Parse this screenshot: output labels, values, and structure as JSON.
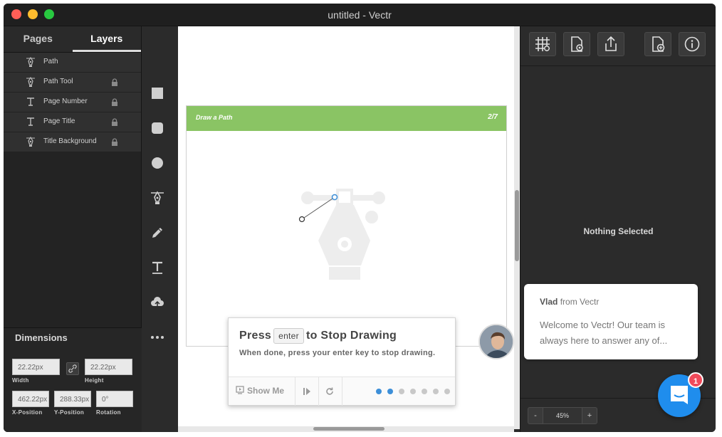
{
  "window": {
    "title": "untitled - Vectr"
  },
  "left_panel": {
    "tabs": [
      {
        "label": "Pages"
      },
      {
        "label": "Layers"
      }
    ],
    "layers": [
      {
        "name": "Path",
        "icon": "pen-icon",
        "locked": false
      },
      {
        "name": "Path Tool",
        "icon": "pen-icon",
        "locked": true
      },
      {
        "name": "Page Number",
        "icon": "text-icon",
        "locked": true
      },
      {
        "name": "Page Title",
        "icon": "text-icon",
        "locked": true
      },
      {
        "name": "Title Background",
        "icon": "pen-icon",
        "locked": true
      }
    ],
    "dimensions": {
      "title": "Dimensions",
      "width": {
        "value": "22.22px",
        "label": "Width"
      },
      "height": {
        "value": "22.22px",
        "label": "Height"
      },
      "x": {
        "value": "462.22px",
        "label": "X-Position"
      },
      "y": {
        "value": "288.33px",
        "label": "Y-Position"
      },
      "rotation": {
        "value": "0°",
        "label": "Rotation"
      }
    }
  },
  "tools": [
    "rectangle-tool-icon",
    "rounded-rect-tool-icon",
    "ellipse-tool-icon",
    "pen-tool-icon",
    "pencil-tool-icon",
    "text-tool-icon",
    "upload-tool-icon",
    "more-icon"
  ],
  "canvas": {
    "artboard_title": "Draw a Path",
    "page_number": "2/7"
  },
  "right_panel": {
    "toolbar": [
      "grid-icon",
      "page-settings-icon",
      "share-icon",
      "add-page-icon",
      "info-icon"
    ],
    "status": "Nothing Selected",
    "zoom": {
      "minus": "-",
      "value": "45%",
      "plus": "+"
    }
  },
  "tutorial": {
    "title_before": "Press",
    "key": "enter",
    "title_after": "to Stop Drawing",
    "subtitle": "When done, press your enter key to stop drawing.",
    "show_me": "Show Me",
    "step": 2,
    "total_steps": 7
  },
  "chat": {
    "sender": "Vlad",
    "from": "from Vectr",
    "message": "Welcome to Vectr!  Our team is always here to answer any of...",
    "badge": "1"
  },
  "colors": {
    "accent_green": "#8ac464",
    "chat_blue": "#1f8ded",
    "badge_red": "#f04a5a",
    "dot_active": "#3d8fd8"
  }
}
